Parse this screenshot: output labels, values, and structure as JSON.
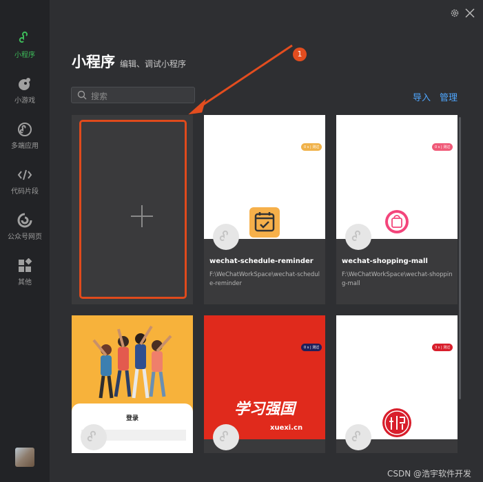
{
  "sidebar": {
    "items": [
      {
        "label": "小程序",
        "icon": "miniprogram-icon",
        "active": true
      },
      {
        "label": "小游戏",
        "icon": "minigame-icon",
        "active": false
      },
      {
        "label": "多端应用",
        "icon": "multiplatform-icon",
        "active": false
      },
      {
        "label": "代码片段",
        "icon": "code-icon",
        "active": false
      },
      {
        "label": "公众号网页",
        "icon": "official-account-icon",
        "active": false
      },
      {
        "label": "其他",
        "icon": "apps-icon",
        "active": false
      }
    ]
  },
  "header": {
    "title": "小程序",
    "subtitle": "编辑、调试小程序",
    "annotation_badge": "1"
  },
  "search": {
    "placeholder": "搜索"
  },
  "actions": {
    "import_label": "导入",
    "manage_label": "管理"
  },
  "projects": [
    {
      "name": "wechat-schedule-reminder",
      "path": "F:\\WeChatWorkSpace\\wechat-schedule-reminder",
      "tag": "0 s | 测过",
      "tag_color": "#f0b24a"
    },
    {
      "name": "wechat-shopping-mall",
      "path": "F:\\WeChatWorkSpace\\wechat-shopping-mall",
      "tag": "0 s | 测过",
      "tag_color": "#f05a78"
    },
    {
      "name": "",
      "path": "",
      "login_text": "登录"
    },
    {
      "name": "",
      "path": "",
      "logo_text": "学习强国",
      "logo_sub": "xuexi.cn",
      "tag": "0 s | 测过"
    },
    {
      "name": "",
      "path": "",
      "tag": "3 s | 测过",
      "tag_color": "#d81e2b"
    }
  ],
  "colors": {
    "accent_green": "#3dbc5a",
    "link_blue": "#4fa7ff",
    "annotation_red": "#e34d1f"
  },
  "watermark": "CSDN @浩宇软件开发"
}
